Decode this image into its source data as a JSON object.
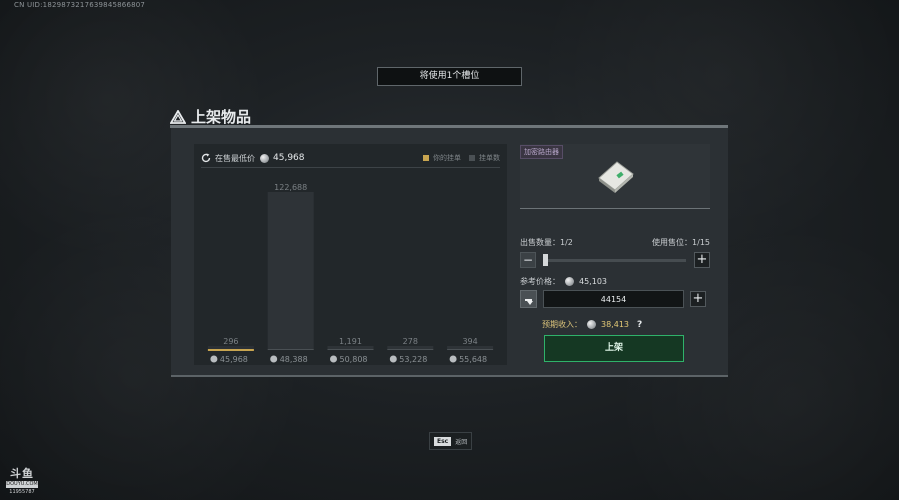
{
  "uid_text": "CN UID:1829873217639845866807",
  "slot_banner": "将使用1个槽位",
  "section_title": "上架物品",
  "chart_header": {
    "label": "在售最低价",
    "lowest_price": "45,968",
    "legend_yours": "你的挂单",
    "legend_listings": "挂单数"
  },
  "chart_data": {
    "type": "bar",
    "categories": [
      "45,968",
      "48,388",
      "50,808",
      "53,228",
      "55,648"
    ],
    "series": [
      {
        "name": "挂单数",
        "values": [
          296,
          122688,
          1191,
          278,
          394
        ]
      }
    ],
    "value_labels": [
      "296",
      "122,688",
      "1,191",
      "278",
      "394"
    ],
    "highlight_index": 0,
    "ylim": [
      0,
      122688
    ]
  },
  "item": {
    "name": "加密路由器"
  },
  "quantity": {
    "label": "出售数量：1/2",
    "slots_label": "使用售位：1/15",
    "value_fraction": 0.0
  },
  "reference_price": {
    "label": "参考价格：",
    "value": "45,103"
  },
  "price_input": {
    "value": "44154"
  },
  "expected_income": {
    "label": "预期收入：",
    "value": "38,413",
    "help": "?"
  },
  "list_button": "上架",
  "esc": {
    "key": "Esc",
    "label": "返回"
  },
  "watermark": {
    "logo": "斗鱼",
    "sub": "DOUYU.COM",
    "room_id": "11955787"
  },
  "colors": {
    "highlight": "#c8a550",
    "bar": "#2e3337",
    "accent_green": "#2fb26a",
    "income": "#e3c976"
  }
}
